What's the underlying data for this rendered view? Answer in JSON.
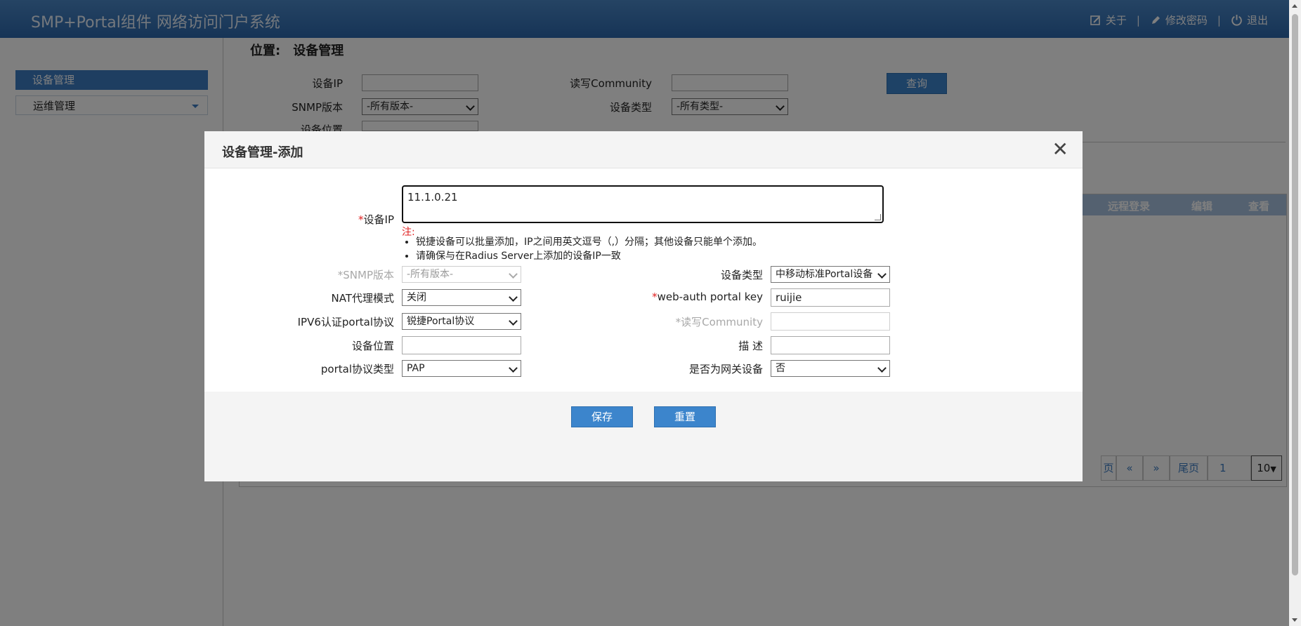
{
  "header": {
    "title": "SMP+Portal组件 网络访问门户系统",
    "about": "关于",
    "change_password": "修改密码",
    "logout": "退出",
    "separator": "|"
  },
  "sidebar": {
    "items": [
      {
        "label": "设备管理",
        "active": true
      },
      {
        "label": "运维管理",
        "active": false
      }
    ]
  },
  "main": {
    "location_label": "位置:",
    "location_value": "设备管理",
    "query": {
      "device_ip_label": "设备IP",
      "rw_community_label": "读写Community",
      "snmp_version_label": "SNMP版本",
      "snmp_version_value": "-所有版本-",
      "device_type_label": "设备类型",
      "device_type_value": "-所有类型-",
      "device_location_label": "设备位置",
      "search_button": "查询"
    },
    "table_headers": [
      "远程登录",
      "编辑",
      "查看"
    ],
    "pager": {
      "first_partial": "页",
      "prev": "«",
      "next": "»",
      "last": "尾页",
      "page": "1",
      "page_size": "10"
    }
  },
  "modal": {
    "title": "设备管理-添加",
    "close": "✕",
    "device_ip_label": "设备IP",
    "device_ip_value": "11.1.0.21",
    "note_title": "注:",
    "notes": [
      "锐捷设备可以批量添加，IP之间用英文逗号（,）分隔；其他设备只能单个添加。",
      "请确保与在Radius Server上添加的设备IP一致"
    ],
    "required_mark": "*",
    "snmp_version_label": "SNMP版本",
    "snmp_version_value": "-所有版本-",
    "device_type_label": "设备类型",
    "device_type_value": "中移动标准Portal设备",
    "nat_mode_label": "NAT代理模式",
    "nat_mode_value": "关闭",
    "webauth_key_label": "web-auth portal key",
    "webauth_key_value": "ruijie",
    "ipv6_protocol_label": "IPV6认证portal协议",
    "ipv6_protocol_value": "锐捷Portal协议",
    "rw_community_label": "读写Community",
    "rw_community_value": "",
    "device_location_label": "设备位置",
    "device_location_value": "",
    "description_label": "描 述",
    "description_value": "",
    "portal_type_label": "portal协议类型",
    "portal_type_value": "PAP",
    "is_gateway_label": "是否为网关设备",
    "is_gateway_value": "否",
    "save_button": "保存",
    "reset_button": "重置"
  },
  "colors": {
    "header_top": "#4b88c8",
    "header_bottom": "#2c68ad",
    "accent": "#3c85cc",
    "required": "#e02020"
  },
  "icons": [
    "about-icon",
    "edit-icon",
    "power-icon",
    "close-icon",
    "chevron-down-icon"
  ]
}
